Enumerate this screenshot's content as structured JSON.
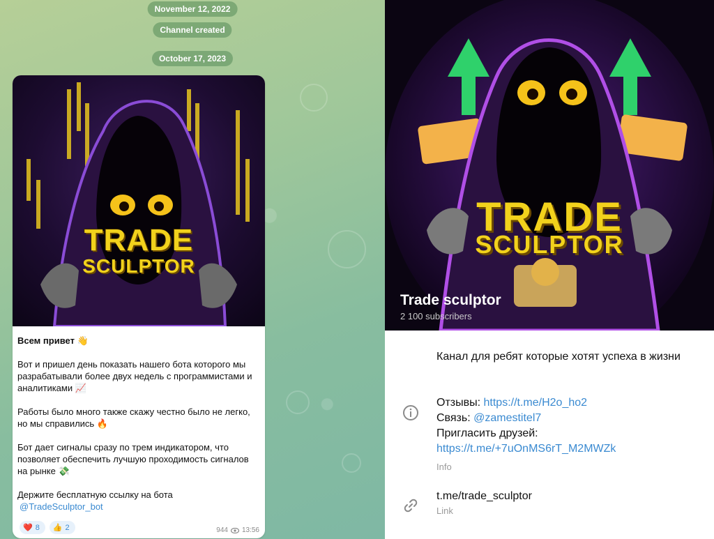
{
  "chat": {
    "date_1": "November 12, 2022",
    "service_msg": "Channel created",
    "date_2": "October 17, 2023",
    "post": {
      "image_title_1": "TRADE",
      "image_title_2": "SCULPTOR",
      "greeting": "Всем привет 👋",
      "p1": "Вот и пришел день показать нашего бота которого мы разрабатывали более двух недель с программистами и аналитиками 📈",
      "p2": "Работы было много также скажу честно было не легко, но мы справились 🔥",
      "p3": "Бот дает сигналы сразу по трем индикатором, что позволяет обеспечить лучшую проходимость сигналов на рынке 💸",
      "p4": "Держите бесплатную ссылку на бота",
      "bot_link": "@TradeSculptor_bot",
      "reactions": [
        {
          "emoji": "❤️",
          "count": "8"
        },
        {
          "emoji": "👍",
          "count": "2"
        }
      ],
      "views": "944",
      "time": "13:56"
    }
  },
  "profile": {
    "cover_title_1": "TRADE",
    "cover_title_2": "SCULPTOR",
    "name": "Trade sculptor",
    "subscribers": "2 100 subscribers",
    "description": "Канал для ребят которые хотят успеха в жизни",
    "info": {
      "reviews_label": "Отзывы: ",
      "reviews_link": "https://t.me/H2o_ho2",
      "contact_label": "Связь: ",
      "contact_link": "@zamestitel7",
      "invite_label": "Пригласить друзей:",
      "invite_link": "https://t.me/+7uOnMS6rT_M2MWZk",
      "caption": "Info"
    },
    "link": {
      "value": "t.me/trade_sculptor",
      "caption": "Link"
    }
  },
  "colors": {
    "link": "#3a8ad1",
    "accent_yellow": "#f2d21c",
    "hood_purple": "#7b3fc2"
  },
  "icons": [
    "info-icon",
    "link-icon",
    "eye-icon",
    "heart-icon",
    "thumbs-up-icon"
  ]
}
